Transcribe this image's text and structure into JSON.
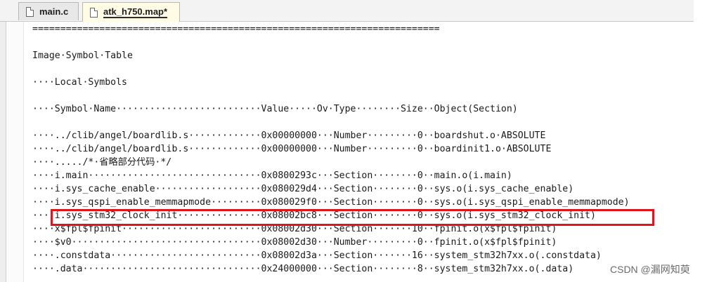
{
  "tabs": [
    {
      "label": "main.c",
      "active": false
    },
    {
      "label": "atk_h750.map*",
      "active": true
    }
  ],
  "editor": {
    "lines": [
      "=========================================================================",
      "",
      "Image·Symbol·Table",
      "",
      "····Local·Symbols",
      "",
      "····Symbol·Name··························Value·····Ov·Type········Size··Object(Section)",
      "",
      "····../clib/angel/boardlib.s·············0x00000000···Number·········0··boardshut.o·ABSOLUTE",
      "····../clib/angel/boardlib.s·············0x00000000···Number·········0··boardinit1.o·ABSOLUTE",
      "····...../*·省略部分代码·*/",
      "····i.main·······························0x0800293c···Section········0··main.o(i.main)",
      "····i.sys_cache_enable···················0x080029d4···Section········0··sys.o(i.sys_cache_enable)",
      "····i.sys_qspi_enable_memmapmode·········0x080029f0···Section········0··sys.o(i.sys_qspi_enable_memmapmode)",
      "····i.sys_stm32_clock_init···············0x08002bc8···Section········0··sys.o(i.sys_stm32_clock_init)",
      "····x$fpl$fpinit·························0x08002d30···Section·······10··fpinit.o(x$fpl$fpinit)",
      "····$v0··································0x08002d30···Number·········0··fpinit.o(x$fpl$fpinit)",
      "····.constdata···························0x08002d3a···Section·······16··system_stm32h7xx.o(.constdata)",
      "····.data································0x24000000···Section········8··system_stm32h7xx.o(.data)"
    ]
  },
  "highlighted_symbol": "i.sys_stm32_clock_init",
  "watermark": "CSDN @漏网知萸",
  "colors": {
    "highlight_border": "#e0141b",
    "active_tab_bg": "#fffbe4"
  }
}
